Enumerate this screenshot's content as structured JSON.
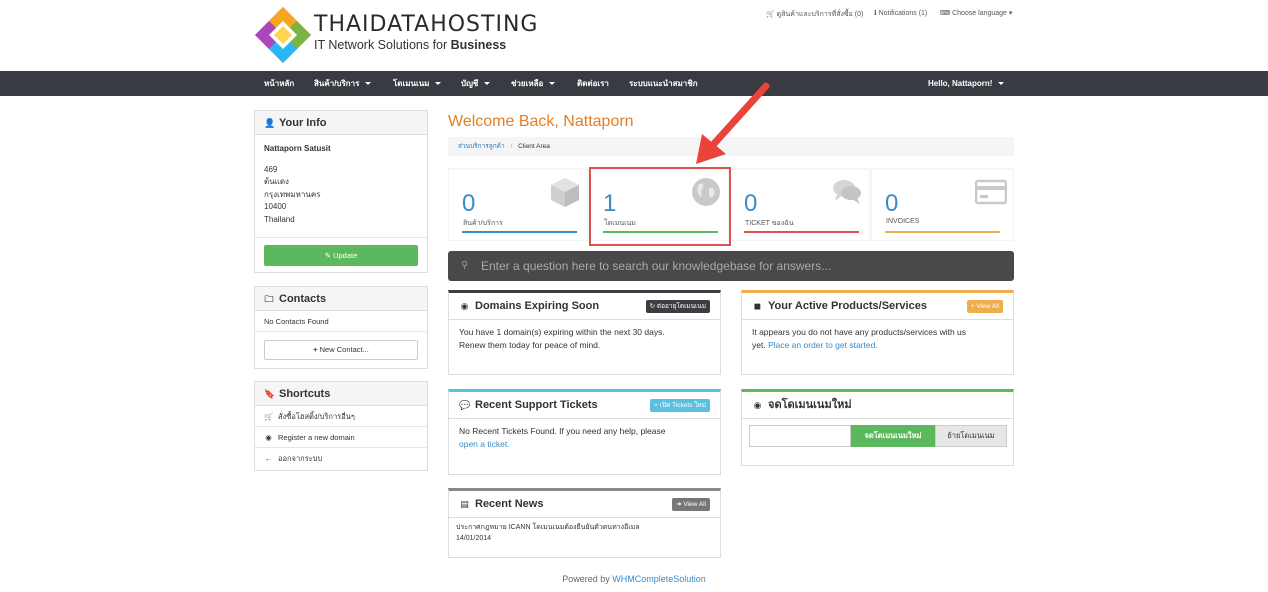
{
  "header": {
    "logo_title": "THAIDATAHOSTING",
    "logo_subtitle_prefix": "IT Network Solutions for ",
    "logo_subtitle_bold": "Business",
    "cart_link": "ดูสินค้าและบริการที่สั่งซื้อ (0)",
    "notifications_link": "Notifications (1)",
    "language_link": "Choose language"
  },
  "nav": {
    "items": [
      "หน้าหลัก",
      "สินค้า/บริการ",
      "โดเมนเนม",
      "บัญชี",
      "ช่วยเหลือ",
      "ติดต่อเรา",
      "ระบบแนะนำสมาชิก"
    ],
    "user_menu": "Hello, Nattaporn!"
  },
  "your_info": {
    "title": "Your Info",
    "name": "Nattaporn Satusit",
    "address_lines": [
      "469",
      "ต้นแดง",
      "กรุงเทพมหานคร",
      "10400",
      "Thailand"
    ],
    "update_button": "Update"
  },
  "contacts": {
    "title": "Contacts",
    "empty_text": "No Contacts Found",
    "new_button": "New Contact..."
  },
  "shortcuts": {
    "title": "Shortcuts",
    "items": [
      "สั่งซื้อโฮสติ้ง/บริการอื่นๆ",
      "Register a new domain",
      "ออกจากระบบ"
    ]
  },
  "main": {
    "welcome": "Welcome Back, Nattaporn",
    "breadcrumb_home": "ส่วนบริการลูกค้า",
    "breadcrumb_sep": "/",
    "breadcrumb_current": "Client Area",
    "stats": [
      {
        "value": "0",
        "label": "สินค้า/บริการ",
        "color": "#3a8bc8"
      },
      {
        "value": "1",
        "label": "โดเมนเนม",
        "color": "#5cb85c"
      },
      {
        "value": "0",
        "label": "TICKET ของฉัน",
        "color": "#d9534f"
      },
      {
        "value": "0",
        "label": "INVOICES",
        "color": "#f0ad4e"
      }
    ],
    "search_placeholder": "Enter a question here to search our knowledgebase for answers..."
  },
  "cards": {
    "domains": {
      "title": "Domains Expiring Soon",
      "badge": "ต่ออายุโดเมนเนม",
      "line1": "You have 1 domain(s) expiring within the next 30 days.",
      "line2": "Renew them today for peace of mind."
    },
    "products": {
      "title": "Your Active Products/Services",
      "badge": "View All",
      "line1": "It appears you do not have any products/services with us",
      "line2_prefix": "yet. ",
      "line2_link": "Place an order to get started."
    },
    "tickets": {
      "title": "Recent Support Tickets",
      "badge": "เปิด Tickets ใหม่",
      "line1": "No Recent Tickets Found. If you need any help, please",
      "line2_link": "open a ticket."
    },
    "register": {
      "title": "จดโดเมนเนมใหม่",
      "register_button": "จดโดเมนเนมใหม่",
      "transfer_button": "ย้ายโดเมนเนม",
      "input_value": ""
    },
    "news": {
      "title": "Recent News",
      "badge": "View All",
      "item_text": "ประกาศกฎหมาย ICANN โดเมนเนมต้องยืนยันตัวตนทางอีเมล",
      "item_date": "14/01/2014"
    }
  },
  "footer": {
    "prefix": "Powered by ",
    "link": "WHMCompleteSolution"
  },
  "colors": {
    "accent_orange": "#e67e22",
    "nav_bg": "#383b41",
    "arrow": "#e8443a",
    "highlight_box": "#d9534f"
  }
}
